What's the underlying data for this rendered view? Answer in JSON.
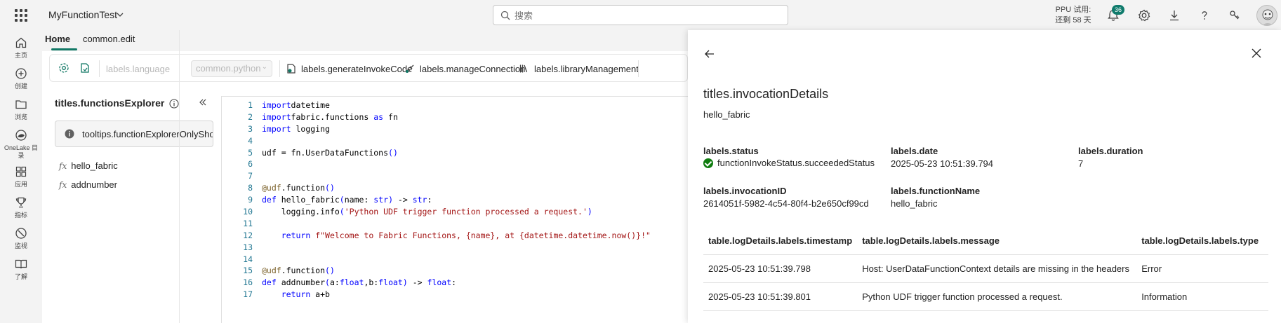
{
  "topbar": {
    "workspace": "MyFunctionTest",
    "search_placeholder": "搜索",
    "trial_line1": "PPU 试用:",
    "trial_line2": "还剩 58 天",
    "notification_count": "36"
  },
  "rail": {
    "items": [
      {
        "label": "主页",
        "icon": "home-icon"
      },
      {
        "label": "创建",
        "icon": "create-icon"
      },
      {
        "label": "浏览",
        "icon": "folder-icon"
      },
      {
        "label": "OneLake 目录",
        "icon": "onelake-icon"
      },
      {
        "label": "应用",
        "icon": "apps-icon"
      },
      {
        "label": "指标",
        "icon": "trophy-icon"
      },
      {
        "label": "监视",
        "icon": "monitor-icon"
      },
      {
        "label": "了解",
        "icon": "book-icon"
      }
    ]
  },
  "tabs": [
    {
      "label": "Home",
      "active": true
    },
    {
      "label": "common.edit",
      "active": false
    }
  ],
  "ribbon": {
    "language_label": "labels.language",
    "language_value": "common.python",
    "generate": "labels.generateInvokeCode",
    "connection": "labels.manageConnection",
    "library": "labels.libraryManagement"
  },
  "explorer": {
    "title": "titles.functionsExplorer",
    "tooltip": "tooltips.functionExplorerOnlyShow",
    "functions": [
      "hello_fabric",
      "addnumber"
    ]
  },
  "code": {
    "lines": [
      {
        "n": "1",
        "segs": [
          [
            "kw",
            "import"
          ],
          [
            "",
            "datetime"
          ]
        ]
      },
      {
        "n": "2",
        "segs": [
          [
            "kw",
            "import"
          ],
          [
            "",
            "fabric.functions "
          ],
          [
            "kw",
            "as"
          ],
          [
            "",
            " fn"
          ]
        ]
      },
      {
        "n": "3",
        "segs": [
          [
            "kw",
            "import"
          ],
          [
            "",
            " logging"
          ]
        ]
      },
      {
        "n": "4",
        "segs": []
      },
      {
        "n": "5",
        "segs": [
          [
            "",
            "udf = fn.UserDataFunctions"
          ],
          [
            "kw",
            "()"
          ]
        ]
      },
      {
        "n": "6",
        "segs": []
      },
      {
        "n": "7",
        "segs": []
      },
      {
        "n": "8",
        "segs": [
          [
            "dec",
            "@udf"
          ],
          [
            "",
            ".function"
          ],
          [
            "kw",
            "()"
          ]
        ]
      },
      {
        "n": "9",
        "segs": [
          [
            "kw",
            "def"
          ],
          [
            "",
            " hello_fabric"
          ],
          [
            "kw",
            "("
          ],
          [
            "",
            "name: "
          ],
          [
            "kw",
            "str"
          ],
          [
            "kw",
            ")"
          ],
          [
            "",
            " -> "
          ],
          [
            "kw",
            "str"
          ],
          [
            "",
            ":"
          ]
        ]
      },
      {
        "n": "10",
        "segs": [
          [
            "",
            "    logging.info"
          ],
          [
            "kw",
            "("
          ],
          [
            "st",
            "'Python UDF trigger function processed a request.'"
          ],
          [
            "kw",
            ")"
          ]
        ]
      },
      {
        "n": "11",
        "segs": []
      },
      {
        "n": "12",
        "segs": [
          [
            "",
            "    "
          ],
          [
            "kw",
            "return"
          ],
          [
            "",
            " "
          ],
          [
            "st",
            "f\"Welcome to Fabric Functions, {name}, at {datetime.datetime.now()}!\""
          ]
        ]
      },
      {
        "n": "13",
        "segs": []
      },
      {
        "n": "14",
        "segs": []
      },
      {
        "n": "15",
        "segs": [
          [
            "dec",
            "@udf"
          ],
          [
            "",
            ".function"
          ],
          [
            "kw",
            "()"
          ]
        ]
      },
      {
        "n": "16",
        "segs": [
          [
            "kw",
            "def"
          ],
          [
            "",
            " addnumber"
          ],
          [
            "kw",
            "("
          ],
          [
            "",
            "a:"
          ],
          [
            "kw",
            "float"
          ],
          [
            "",
            ",b:"
          ],
          [
            "kw",
            "float"
          ],
          [
            "kw",
            ")"
          ],
          [
            "",
            " -> "
          ],
          [
            "kw",
            "float"
          ],
          [
            "",
            ":"
          ]
        ]
      },
      {
        "n": "17",
        "segs": [
          [
            "",
            "    "
          ],
          [
            "kw",
            "return"
          ],
          [
            "",
            " a+b"
          ]
        ]
      }
    ]
  },
  "panel": {
    "title": "titles.invocationDetails",
    "subtitle": "hello_fabric",
    "status_label": "labels.status",
    "status_value": "functionInvokeStatus.succeededStatus",
    "date_label": "labels.date",
    "date_value": "2025-05-23 10:51:39.794",
    "duration_label": "labels.duration",
    "duration_value": "7",
    "invocation_label": "labels.invocationID",
    "invocation_value": "2614051f-5982-4c54-80f4-b2e650cf99cd",
    "fname_label": "labels.functionName",
    "fname_value": "hello_fabric",
    "table": {
      "headers": [
        "table.logDetails.labels.timestamp",
        "table.logDetails.labels.message",
        "table.logDetails.labels.type"
      ],
      "rows": [
        [
          "2025-05-23 10:51:39.798",
          "Host: UserDataFunctionContext details are missing in the headers",
          "Error"
        ],
        [
          "2025-05-23 10:51:39.801",
          "Python UDF trigger function processed a request.",
          "Information"
        ]
      ]
    }
  }
}
